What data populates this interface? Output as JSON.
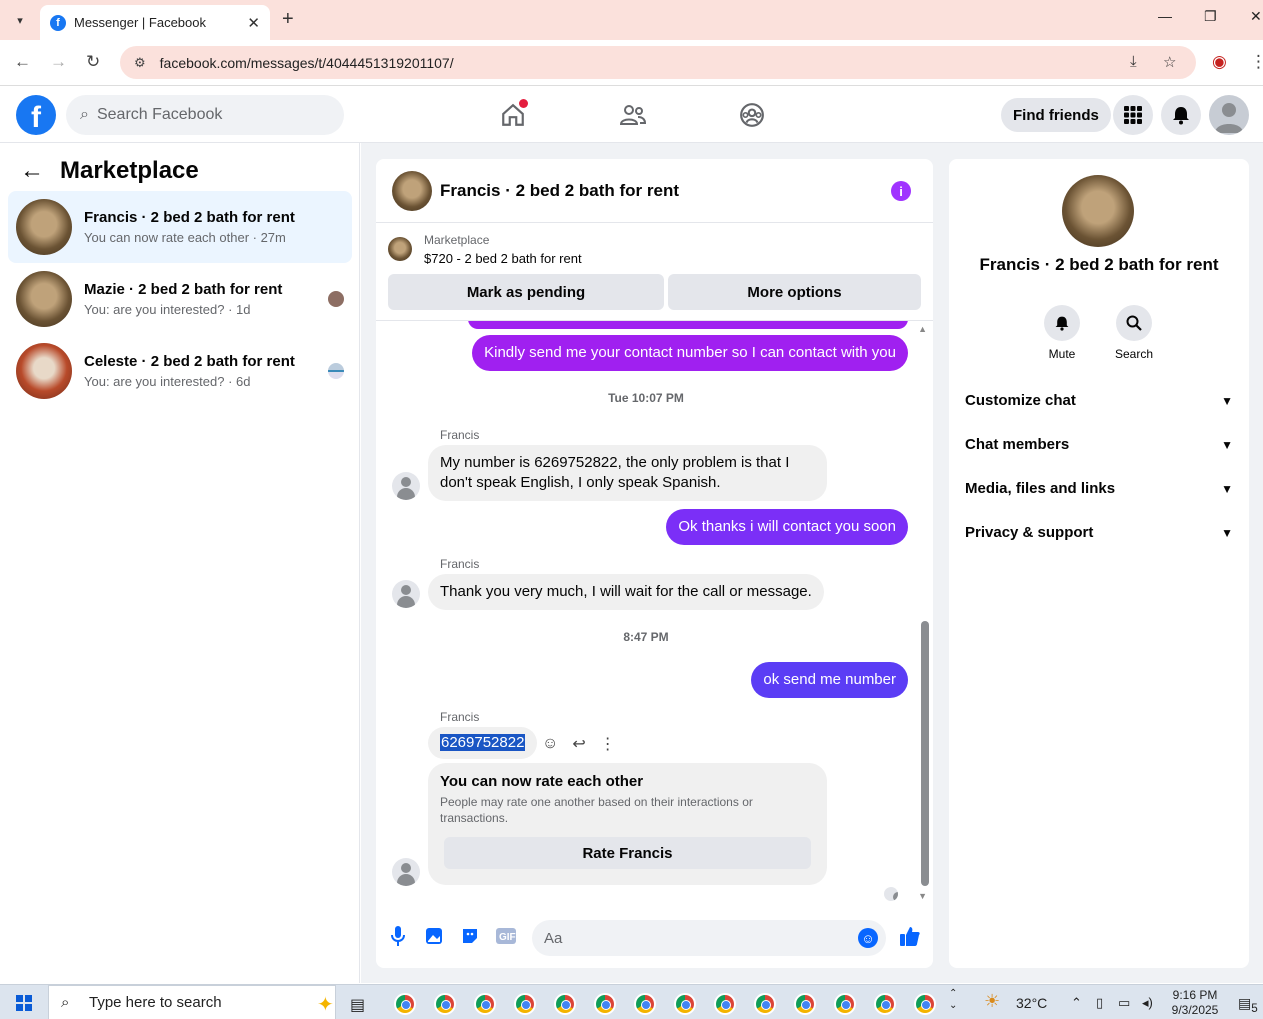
{
  "browser": {
    "tab_title": "Messenger | Facebook",
    "url": "facebook.com/messages/t/4044451319201107/"
  },
  "fb_header": {
    "search_placeholder": "Search Facebook",
    "find_friends": "Find friends"
  },
  "left_pane": {
    "title": "Marketplace",
    "conversations": [
      {
        "name": "Francis · 2 bed 2 bath for rent",
        "preview": "You can now rate each other · 27m"
      },
      {
        "name": "Mazie · 2 bed 2 bath for rent",
        "preview": "You: are you interested? · 1d"
      },
      {
        "name": "Celeste · 2 bed 2 bath for rent",
        "preview": "You: are you interested? · 6d"
      }
    ]
  },
  "chat": {
    "header_name": "Francis · 2 bed 2 bath for rent",
    "marketplace_label": "Marketplace",
    "listing": "$720 - 2 bed 2 bath for rent",
    "mark_pending": "Mark as pending",
    "more_options": "More options",
    "messages": {
      "m1": "Kindly send me your contact number so I can contact with you",
      "ts1": "Tue 10:07 PM",
      "sender": "Francis",
      "m2": "My number is 6269752822, the only problem is that I don't speak English, I only speak Spanish.",
      "m3": "Ok thanks i will contact you soon",
      "m4": "Thank you very much, I will wait for the call or message.",
      "ts2": "8:47 PM",
      "m5": "ok send me number",
      "m6": "6269752822"
    },
    "rate_card": {
      "title": "You can now rate each other",
      "desc": "People may rate one another based on their interactions or transactions.",
      "button": "Rate Francis"
    },
    "composer_placeholder": "Aa"
  },
  "right_pane": {
    "name": "Francis · 2 bed 2 bath for rent",
    "mute": "Mute",
    "search": "Search",
    "sections": [
      "Customize chat",
      "Chat members",
      "Media, files and links",
      "Privacy & support"
    ]
  },
  "taskbar": {
    "search_placeholder": "Type here to search",
    "temp": "32°C",
    "time": "9:16 PM",
    "date": "9/3/2025",
    "notif_count": "5"
  }
}
